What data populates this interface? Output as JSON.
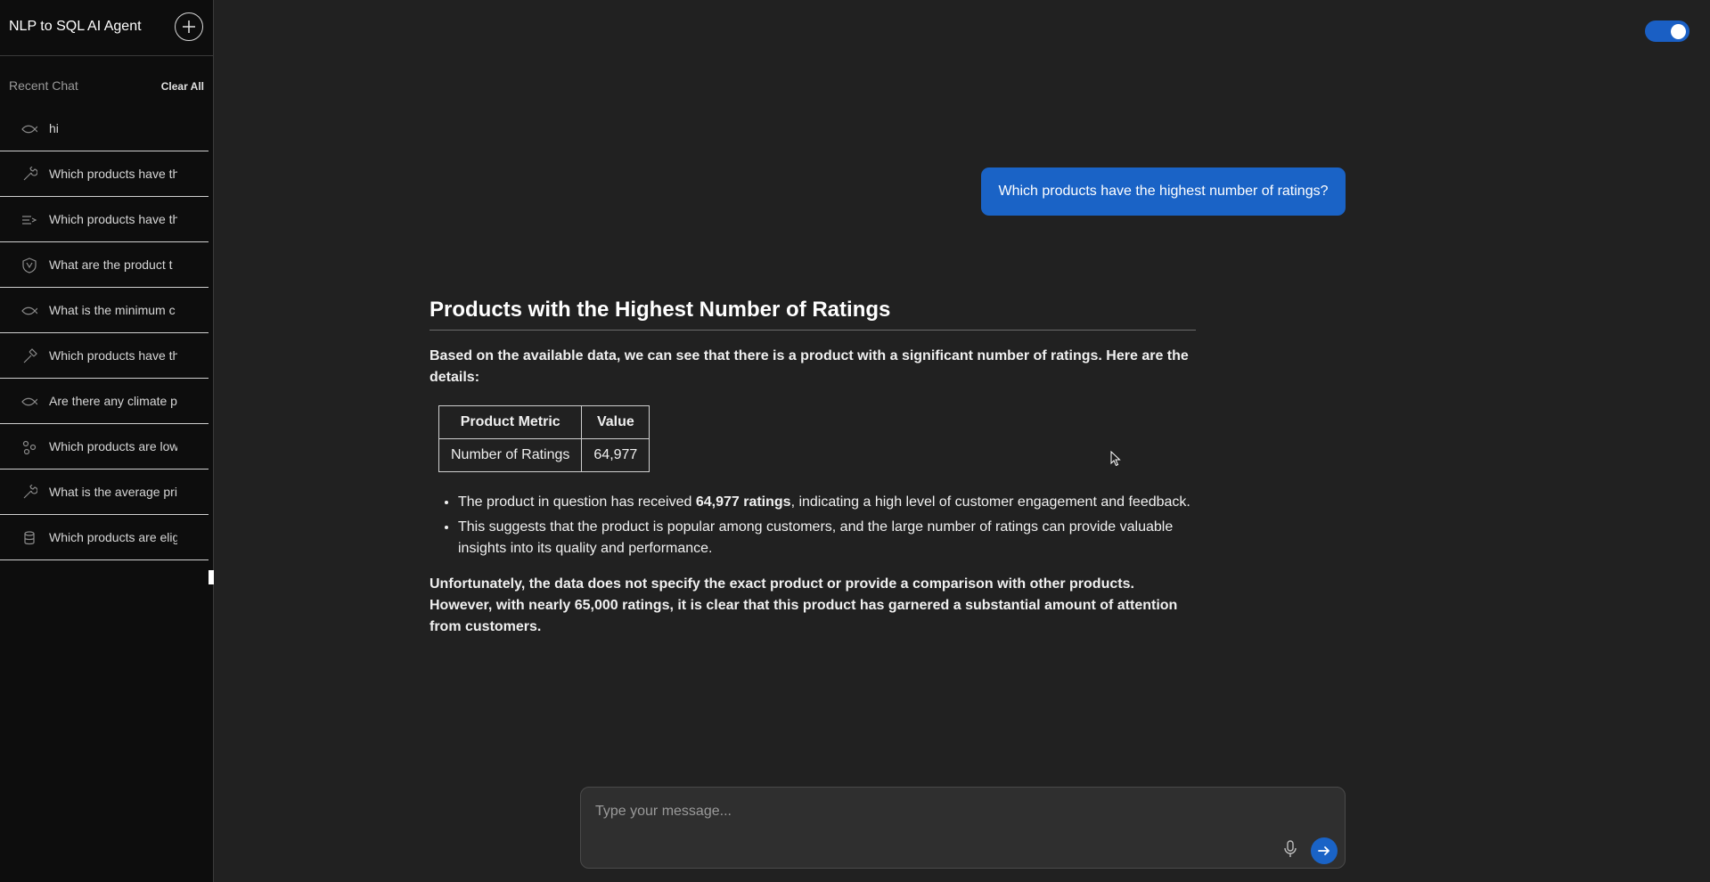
{
  "sidebar": {
    "app_title": "NLP to SQL AI Agent",
    "recent_label": "Recent Chat",
    "clear_all": "Clear All",
    "items": [
      {
        "label": "hi",
        "icon": "fish-icon"
      },
      {
        "label": "Which products have th",
        "icon": "wrench-icon"
      },
      {
        "label": "Which products have th",
        "icon": "list-arrow-icon"
      },
      {
        "label": "What are the product t",
        "icon": "shield-icon"
      },
      {
        "label": "What is the minimum c",
        "icon": "fish-icon"
      },
      {
        "label": "Which products have th",
        "icon": "hammer-icon"
      },
      {
        "label": "Are there any climate p",
        "icon": "fish-icon"
      },
      {
        "label": "Which products are low",
        "icon": "molecule-icon"
      },
      {
        "label": "What is the average pri",
        "icon": "wrench-icon"
      },
      {
        "label": "Which products are elig",
        "icon": "database-icon"
      }
    ]
  },
  "header": {
    "toggle_state": "on",
    "toggle_color": "#1a5fc4"
  },
  "chat": {
    "user_message": "Which products have the highest number of ratings?",
    "response": {
      "title": "Products with the Highest Number of Ratings",
      "intro": "Based on the available data, we can see that there is a product with a significant number of ratings. Here are the details:",
      "table": {
        "headers": [
          "Product Metric",
          "Value"
        ],
        "rows": [
          [
            "Number of Ratings",
            "64,977"
          ]
        ]
      },
      "bullets": [
        {
          "pre": "The product in question has received ",
          "bold": "64,977 ratings",
          "post": ", indicating a high level of customer engagement and feedback."
        },
        {
          "pre": "This suggests that the product is popular among customers, and the large number of ratings can provide valuable insights into its quality and performance.",
          "bold": "",
          "post": ""
        }
      ],
      "outro": {
        "pre": "Unfortunately, the data does not specify the exact product or provide a comparison with other products. However, with nearly ",
        "bold": "65,000 ratings",
        "post": ", it is clear that this product has garnered a substantial amount of attention from customers."
      }
    }
  },
  "composer": {
    "placeholder": "Type your message...",
    "value": ""
  },
  "colors": {
    "accent": "#1a63c6",
    "background": "#212121",
    "sidebar": "#0d0d0d"
  }
}
